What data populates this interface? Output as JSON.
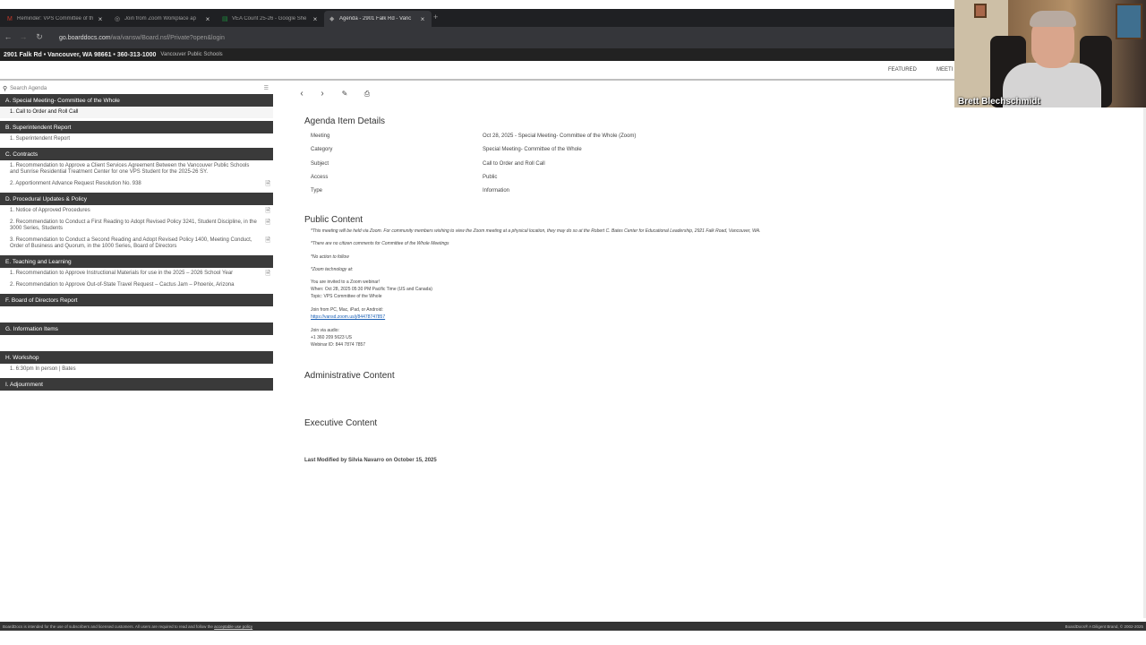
{
  "browser": {
    "tabs": [
      {
        "label": "Reminder: VPS Committee of th",
        "icon": "mail-icon",
        "icon_color": "#c53929"
      },
      {
        "label": "Join from Zoom Workplace ap",
        "icon": "zoom-icon",
        "icon_color": "#9a9a9a"
      },
      {
        "label": "VEA Count 25-26 - Google She",
        "icon": "sheets-icon",
        "icon_color": "#1e8e3e"
      },
      {
        "label": "Agenda - 2901 Falk Rd - Vanc",
        "icon": "boarddocs-icon",
        "icon_color": "#9a9a9a"
      }
    ],
    "new_tab": "+",
    "url_host": "go.boarddocs.com",
    "url_path": "/wa/vansw/Board.nsf/Private?open&login"
  },
  "header": {
    "address": "2901 Falk Rd • Vancouver, WA 98661 • 360-313-1000",
    "org": "Vancouver Public Schools"
  },
  "topnav": {
    "featured": "FEATURED",
    "meetings": "MEETI"
  },
  "sidebar": {
    "search_placeholder": "Search Agenda",
    "sections": [
      {
        "label": "A. Special Meeting- Committee of the Whole",
        "items": [
          {
            "label": "1. Call to Order and Roll Call",
            "selected": true,
            "doc": false
          }
        ]
      },
      {
        "label": "B. Superintendent Report",
        "items": [
          {
            "label": "1. Superintendent Report",
            "selected": false,
            "doc": false
          }
        ]
      },
      {
        "label": "C. Contracts",
        "items": [
          {
            "label": "1. Recommendation to Approve a Client Services Agreement Between the Vancouver Public Schools and Sunrise Residential Treatment Center for one VPS Student for the 2025-26 SY.",
            "selected": false,
            "doc": false
          },
          {
            "label": "2. Apportionment Advance Request Resolution No. 938",
            "selected": false,
            "doc": true
          }
        ]
      },
      {
        "label": "D. Procedural Updates & Policy",
        "items": [
          {
            "label": "1. Notice of Approved Procedures",
            "selected": false,
            "doc": true
          },
          {
            "label": "2. Recommendation to Conduct a First Reading to Adopt Revised Policy 3241, Student Discipline, in the 3000 Series, Students",
            "selected": false,
            "doc": true
          },
          {
            "label": "3. Recommendation to Conduct a Second Reading and Adopt Revised Policy 1400, Meeting Conduct, Order of Business and Quorum, in the 1000 Series, Board of Directors",
            "selected": false,
            "doc": true
          }
        ]
      },
      {
        "label": "E. Teaching and Learning",
        "items": [
          {
            "label": "1. Recommendation to Approve Instructional Materials for use in the 2025 – 2026 School Year",
            "selected": false,
            "doc": true
          },
          {
            "label": "2. Recommendation to Approve Out-of-State Travel Request – Cactus Jam – Phoenix, Arizona",
            "selected": false,
            "doc": false
          }
        ]
      },
      {
        "label": "F. Board of Directors Report",
        "items": []
      },
      {
        "label": "G. Information Items",
        "items": []
      },
      {
        "label": "H. Workshop",
        "items": [
          {
            "label": "1. 6:30pm In person | Bates",
            "selected": false,
            "doc": false
          }
        ]
      },
      {
        "label": "I. Adjournment",
        "items": []
      }
    ]
  },
  "details": {
    "title": "Agenda Item Details",
    "rows": [
      {
        "label": "Meeting",
        "value": "Oct 28, 2025 - Special Meeting- Committee of the Whole (Zoom)"
      },
      {
        "label": "Category",
        "value": "Special Meeting- Committee of the Whole"
      },
      {
        "label": "Subject",
        "value": "Call to Order and Roll Call"
      },
      {
        "label": "Access",
        "value": "Public"
      },
      {
        "label": "Type",
        "value": "Information"
      }
    ]
  },
  "public": {
    "title": "Public Content",
    "l1": "*This meeting will be held via Zoom.  For community members wishing to view the Zoom meeting at a physical location, they may do so at the Robert C. Bates Center for Educational Leadership, 2921 Falk Road, Vancouver, WA.",
    "l2": "*There are no citizen comments for Committee of the Whole Meetings",
    "l3": "*No action to follow",
    "l4": "*Zoom technology at:",
    "l5": "You are invited to a Zoom webinar!",
    "l6": "When: Oct 28, 2025 05:30 PM Pacific Time (US and Canada)",
    "l7": "Topic: VPS Committee of the Whole",
    "l8": "Join from PC, Mac, iPad, or Android:",
    "l9": "https://vansd.zoom.us/j/84478747857",
    "l10": "Join via audio:",
    "l11": "+1 360 209 5623 US",
    "l12": "Webinar ID: 844 7874 7857"
  },
  "admin_title": "Administrative Content",
  "exec_title": "Executive Content",
  "last_modified": "Last Modified by Silvia Navarro on October 15, 2025",
  "footer": {
    "left": "BoardDocs is intended for the use of subscribers and licensed customers. All users are required to read and follow the",
    "link": "acceptable use policy",
    "right": "BoardDocs® A Diligent Brand, © 2002-2025"
  },
  "webcam": {
    "name": "Brett Blechschmidt"
  }
}
